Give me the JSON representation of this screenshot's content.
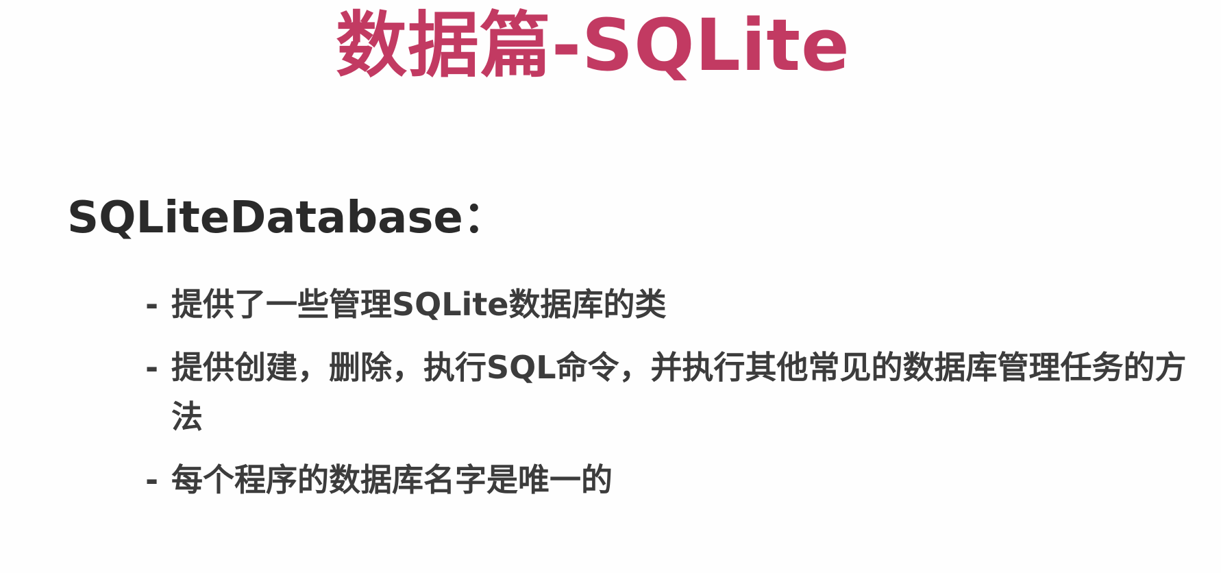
{
  "slide": {
    "title": "数据篇-SQLite",
    "title_color": "#c23a62",
    "heading": "SQLiteDatabase：",
    "bullet_marker": "-",
    "bullets": [
      "提供了一些管理SQLite数据库的类",
      "提供创建，删除，执行SQL命令，并执行其他常见的数据库管理任务的方法",
      "每个程序的数据库名字是唯一的"
    ]
  }
}
